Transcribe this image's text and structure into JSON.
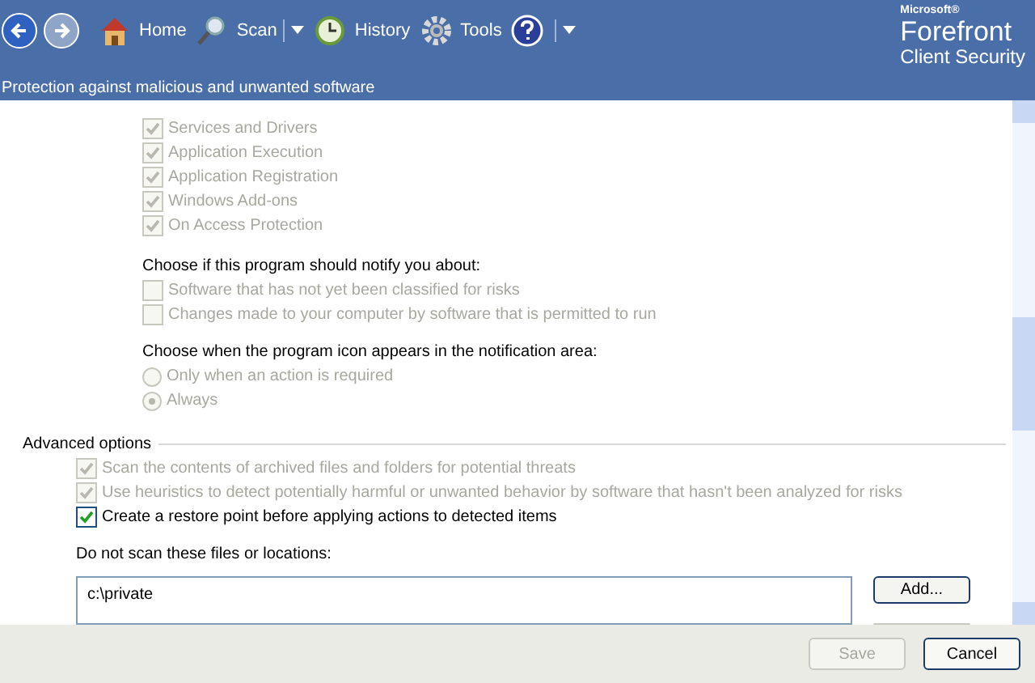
{
  "toolbar": {
    "items": [
      {
        "label": "Home",
        "kind": "home",
        "dropdown": false
      },
      {
        "label": "Scan",
        "kind": "scan",
        "dropdown": true
      },
      {
        "label": "History",
        "kind": "history",
        "dropdown": false
      },
      {
        "label": "Tools",
        "kind": "tools",
        "dropdown": false
      }
    ],
    "help_dropdown": true
  },
  "brand": {
    "vendor": "Microsoft®",
    "name": "Forefront",
    "product": "Client Security"
  },
  "subtitle": "Protection against malicious and unwanted software",
  "protection_items": [
    {
      "label": "Services and Drivers",
      "checked": true,
      "disabled": true
    },
    {
      "label": "Application Execution",
      "checked": true,
      "disabled": true
    },
    {
      "label": "Application Registration",
      "checked": true,
      "disabled": true
    },
    {
      "label": "Windows Add-ons",
      "checked": true,
      "disabled": true
    },
    {
      "label": "On Access Protection",
      "checked": true,
      "disabled": true
    }
  ],
  "notify": {
    "heading": "Choose if this program should notify you about:",
    "options": [
      {
        "label": "Software that has not yet been classified for risks",
        "checked": false,
        "disabled": true
      },
      {
        "label": "Changes made to your computer by software that is permitted to run",
        "checked": false,
        "disabled": true
      }
    ]
  },
  "icon_area": {
    "heading": "Choose when the program icon appears in the notification area:",
    "options": [
      {
        "label": "Only when an action is required",
        "selected": false,
        "disabled": true
      },
      {
        "label": "Always",
        "selected": true,
        "disabled": true
      }
    ]
  },
  "advanced": {
    "heading": "Advanced options",
    "options": [
      {
        "label": "Scan the contents of archived files and folders for potential threats",
        "checked": true,
        "disabled": true
      },
      {
        "label": "Use heuristics to detect potentially harmful or unwanted behavior by software that hasn't been analyzed for risks",
        "checked": true,
        "disabled": true
      },
      {
        "label": "Create a restore point before applying actions to detected items",
        "checked": true,
        "disabled": false
      }
    ]
  },
  "exclusions": {
    "label": "Do not scan these files or locations:",
    "entries": [
      "c:\\private"
    ],
    "add_button": "Add..."
  },
  "footer": {
    "buttons": [
      {
        "label": "Save",
        "disabled": true
      },
      {
        "label": "Cancel",
        "disabled": false
      }
    ]
  }
}
